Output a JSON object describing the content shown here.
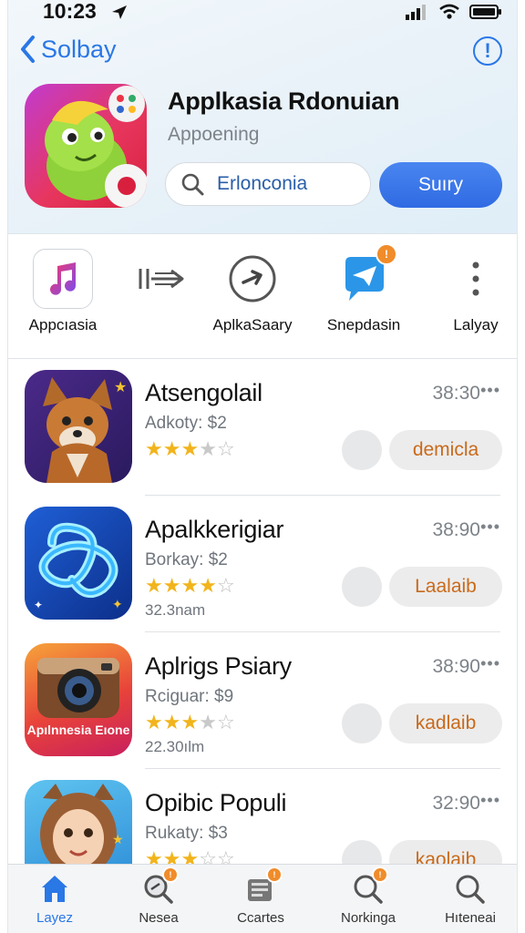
{
  "status_bar": {
    "time": "10:23"
  },
  "nav": {
    "back_label": "Solbay"
  },
  "app": {
    "title": "Applkasia Rdonuian",
    "subtitle": "Appoening"
  },
  "search": {
    "value": "Erlonconia"
  },
  "primary_button": {
    "label": "Suıry"
  },
  "shortcuts": [
    {
      "label": "Appcıasia",
      "icon": "music-note-icon"
    },
    {
      "label": "",
      "icon": "arrow-forward-icon"
    },
    {
      "label": "AplkaSaary",
      "icon": "circle-arrow-icon"
    },
    {
      "label": "Snepdasin",
      "icon": "chat-send-icon",
      "badge": "!"
    },
    {
      "label": "Lalyay",
      "icon": "more-vertical-icon"
    }
  ],
  "apps": [
    {
      "name": "Atsengolail",
      "sub": "Adkoty: $2",
      "rating": 3.5,
      "meta": "",
      "time": "38:30",
      "action": "demicla",
      "thumb": "fox"
    },
    {
      "name": "Apalkkerigiar",
      "sub": "Borkay: $2",
      "rating": 4,
      "meta": "32.3nam",
      "time": "38:90",
      "action": "Laalaib",
      "thumb": "knot"
    },
    {
      "name": "Aplrigs Psiary",
      "sub": "Rciguar: $9",
      "rating": 3.5,
      "meta": "22.30ılm",
      "time": "38:90",
      "action": "kadlaib",
      "thumb": "camera",
      "thumb_text": "Apılnnesia Eıone"
    },
    {
      "name": "Opibic Populi",
      "sub": "Rukaty: $3",
      "rating": 3,
      "meta": "",
      "time": "32:90",
      "action": "kaolaib",
      "thumb": "girl"
    }
  ],
  "tabs": [
    {
      "label": "Layez",
      "icon": "home-icon",
      "active": true
    },
    {
      "label": "Nesea",
      "icon": "search-badge-icon",
      "badge": true
    },
    {
      "label": "Ccartes",
      "icon": "cards-icon",
      "badge": true
    },
    {
      "label": "Norkinga",
      "icon": "search-alert-icon",
      "badge": true
    },
    {
      "label": "Hıteneai",
      "icon": "search-icon"
    }
  ],
  "colors": {
    "accent": "#2a77e6",
    "star": "#f2b41c",
    "action_text": "#c96a1b"
  }
}
